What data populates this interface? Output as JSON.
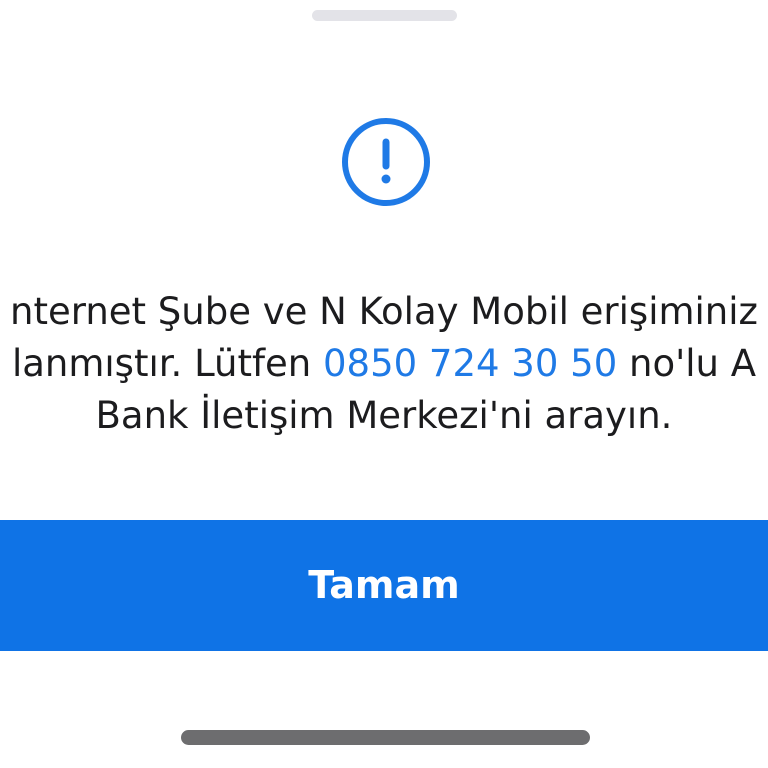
{
  "dialog": {
    "icon": "exclamation-circle-icon",
    "message": {
      "line1": "nternet Şube ve N Kolay Mobil erişiminiz",
      "line2_before": "lanmıştır. Lütfen ",
      "phone": "0850 724 30 50",
      "line2_after": " no'lu A",
      "line3": "Bank İletişim Merkezi'ni arayın."
    },
    "ok_label": "Tamam"
  },
  "colors": {
    "accent": "#1F7AE6",
    "button": "#0F73E6",
    "text": "#1C1C1E",
    "background": "#FFFFFF"
  }
}
